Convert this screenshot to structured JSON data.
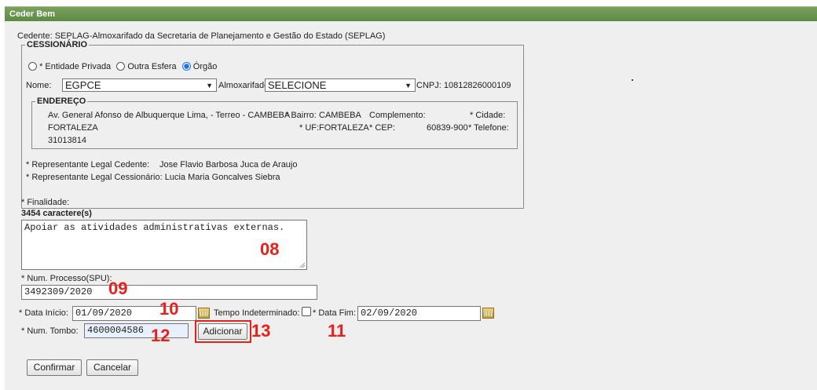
{
  "window": {
    "title": "Ceder Bem"
  },
  "cedente": {
    "label": "Cedente:",
    "value": "SEPLAG-Almoxarifado da Secretaria de Planejamento e Gestão do Estado (SEPLAG)"
  },
  "cessionario": {
    "legend": "CESSIONÁRIO",
    "radios": [
      {
        "label": "* Entidade Privada",
        "selected": false
      },
      {
        "label": "Outra Esfera",
        "selected": false
      },
      {
        "label": "Órgão",
        "selected": true
      }
    ],
    "nome_label": "Nome:",
    "nome_value": "EGPCE",
    "almox_label": "Almoxarifado",
    "almox_value": "SELECIONE",
    "cnpj_label": "CNPJ:",
    "cnpj_value": "10812826000109"
  },
  "endereco": {
    "legend": "ENDEREÇO",
    "street": "Av. General Afonso de Albuquerque Lima, - Terreo - CAMBEBA",
    "bairro_label": "* Bairro:",
    "bairro_value": "CAMBEBA",
    "complemento_label": "Complemento:",
    "complemento_value": "",
    "cidade_label": "* Cidade:",
    "cidade_value": "FORTALEZA",
    "uf_label": "* UF:",
    "uf_value": "FORTALEZA",
    "cep_label": "* CEP:",
    "cep_value": "60839-900",
    "telefone_label": "* Telefone:",
    "telefone_value": "31013814"
  },
  "representantes": {
    "cedente_label": "* Representante Legal Cedente:",
    "cedente_value": "Jose Flavio Barbosa Juca de Araujo",
    "cessionario_label": "* Representante Legal Cessionário:",
    "cessionario_value": "Lucia Maria Goncalves Siebra"
  },
  "finalidade": {
    "label": "* Finalidade:",
    "counter": "3454 caractere(s)",
    "value": "Apoiar as atividades administrativas externas."
  },
  "processo": {
    "label": "* Num. Processo(SPU):",
    "value": "3492309/2020"
  },
  "datas": {
    "inicio_label": "* Data Início:",
    "inicio_value": "01/09/2020",
    "indeterminado_label": "Tempo Indeterminado:",
    "indeterminado_checked": false,
    "fim_label": "* Data Fim:",
    "fim_value": "02/09/2020"
  },
  "tombo": {
    "label": "* Num. Tombo:",
    "value": "4600004586",
    "add_label": "Adicionar"
  },
  "actions": {
    "confirm_label": "Confirmar",
    "cancel_label": "Cancelar"
  },
  "annotations": {
    "a08": "08",
    "a09": "09",
    "a10": "10",
    "a11": "11",
    "a12": "12",
    "a13": "13",
    "color": "#e8201a"
  },
  "colors": {
    "titlebar": "#5c8a42",
    "panel": "#efefef",
    "radio_selected": "#1a73e8"
  }
}
